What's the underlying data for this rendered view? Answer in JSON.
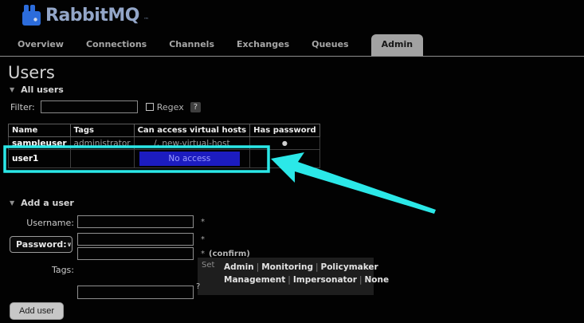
{
  "brand": {
    "name": "RabbitMQ",
    "tm": "™"
  },
  "tabs": {
    "items": [
      {
        "label": "Overview"
      },
      {
        "label": "Connections"
      },
      {
        "label": "Channels"
      },
      {
        "label": "Exchanges"
      },
      {
        "label": "Queues"
      },
      {
        "label": "Admin"
      }
    ],
    "active": "Admin"
  },
  "page": {
    "title": "Users"
  },
  "all_users": {
    "title": "All users",
    "collapse_icon": "▼",
    "filter": {
      "label": "Filter:",
      "value": "",
      "regex_label": "Regex",
      "regex_checked": false,
      "help": "?"
    },
    "table": {
      "headers": [
        "Name",
        "Tags",
        "Can access virtual hosts",
        "Has password"
      ],
      "rows": [
        {
          "name": "sampleuser",
          "tags": "administrator",
          "vhosts": "/, new-virtual-host",
          "has_password": "●"
        },
        {
          "name": "user1",
          "tags": "",
          "vhosts_status": "No access",
          "has_password": "●"
        }
      ]
    }
  },
  "add_user": {
    "title": "Add a user",
    "collapse_icon": "▼",
    "username": {
      "label": "Username:",
      "value": "",
      "required": "*"
    },
    "password": {
      "select_label": "Password:",
      "chevron": "∨",
      "value": "",
      "required": "*",
      "confirm_value": "",
      "confirm_required": "*",
      "confirm_label": "(confirm)"
    },
    "tags": {
      "label": "Tags:",
      "value": "",
      "set_label": "Set",
      "separator": "|",
      "options": [
        "Admin",
        "Monitoring",
        "Policymaker",
        "Management",
        "Impersonator",
        "None"
      ],
      "help": "?"
    },
    "submit": "Add user"
  },
  "colors": {
    "annotation_cyan": "#2be8e8",
    "no_access_bg": "#1c1cc0",
    "no_access_text": "#9d9dff",
    "brand_blue": "#2c6cdb",
    "active_tab_bg": "#a2a2a2"
  }
}
